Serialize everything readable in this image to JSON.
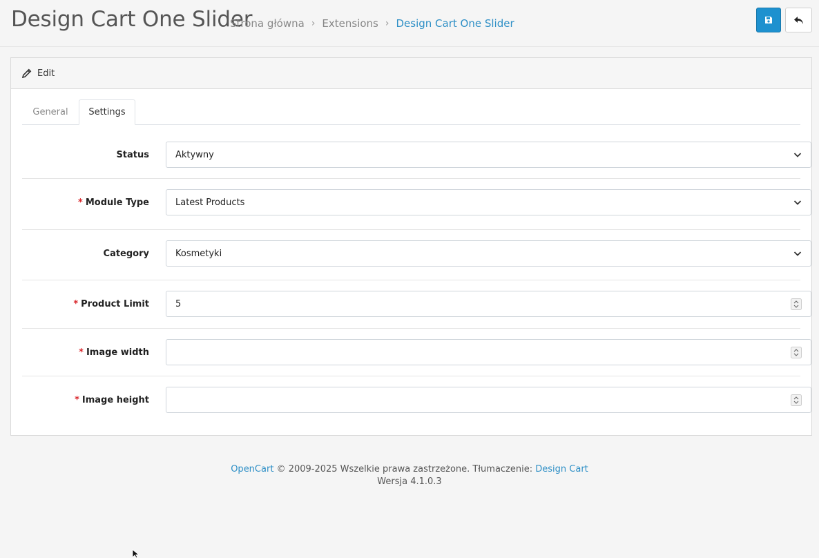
{
  "header": {
    "title": "Design Cart One Slider",
    "breadcrumb": [
      "Strona główna",
      "Extensions",
      "Design Cart One Slider"
    ],
    "save_icon": "save-icon",
    "back_icon": "back-arrow-icon"
  },
  "card": {
    "heading": "Edit",
    "heading_icon": "pencil-icon"
  },
  "tabs": [
    {
      "label": "General",
      "active": false
    },
    {
      "label": "Settings",
      "active": true
    }
  ],
  "form": {
    "status": {
      "label": "Status",
      "value": "Aktywny",
      "required": false
    },
    "module_type": {
      "label": "Module Type",
      "value": "Latest Products",
      "required": true
    },
    "category": {
      "label": "Category",
      "value": "Kosmetyki",
      "required": false
    },
    "product_limit": {
      "label": "Product Limit",
      "value": "5",
      "required": true
    },
    "image_width": {
      "label": "Image width",
      "value": "",
      "required": true
    },
    "image_height": {
      "label": "Image height",
      "value": "",
      "required": true
    }
  },
  "footer": {
    "brand": "OpenCart",
    "copyright": "© 2009-2025 Wszelkie prawa zastrzeżone. Tłumaczenie:",
    "translator": "Design Cart",
    "version": "Wersja 4.1.0.3"
  },
  "colors": {
    "primary": "#1e91cf",
    "link": "#2e8fc6",
    "required": "#d9262b"
  }
}
